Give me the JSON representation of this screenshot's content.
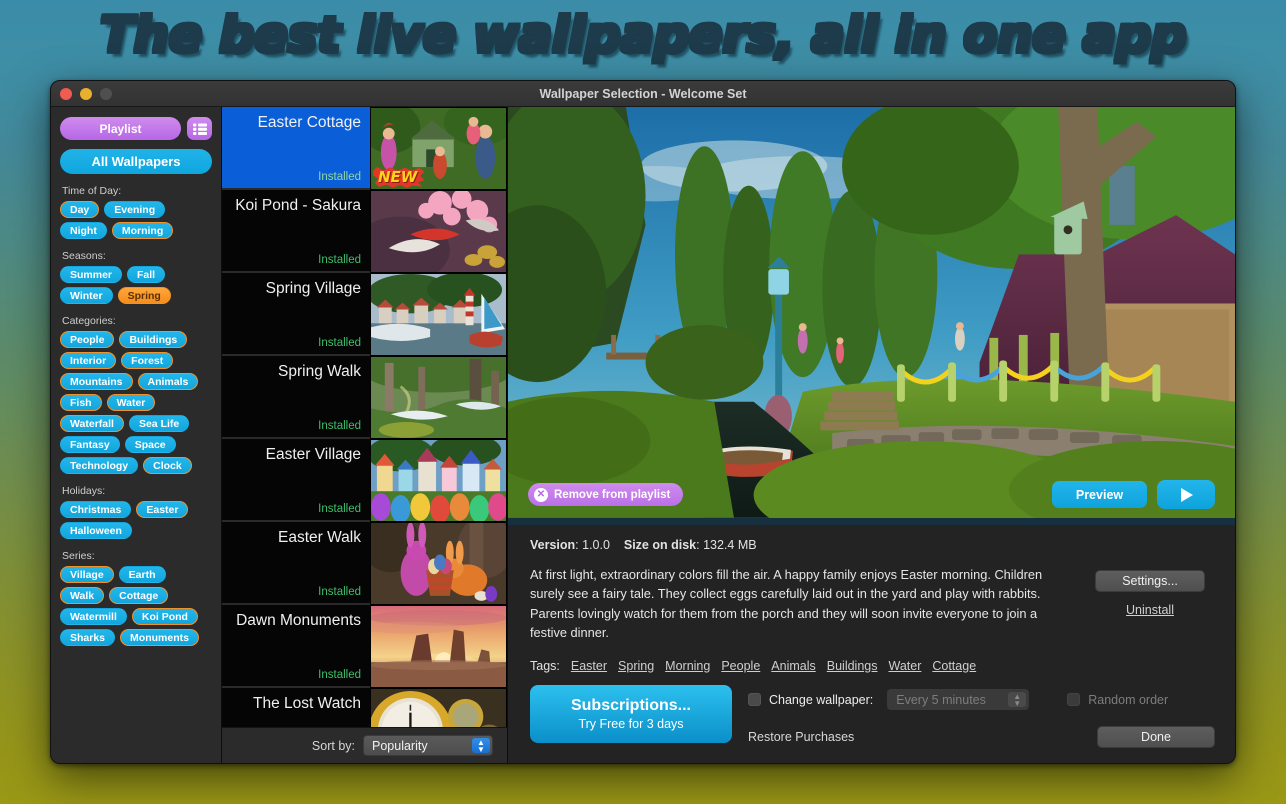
{
  "headline": "The best live wallpapers, all in one app",
  "window": {
    "title": "Wallpaper Selection - Welcome Set",
    "traffic_lights": [
      "close-red",
      "minimize-yellow",
      "zoom-disabled-grey"
    ]
  },
  "sidebar": {
    "playlist_button": "Playlist",
    "list_view_icon": "list-icon",
    "all_wallpapers_button": "All Wallpapers",
    "groups": [
      {
        "label": "Time of Day:",
        "chips": [
          {
            "label": "Day",
            "state": "outlined"
          },
          {
            "label": "Evening",
            "state": "normal"
          },
          {
            "label": "Night",
            "state": "normal"
          },
          {
            "label": "Morning",
            "state": "outlined"
          }
        ]
      },
      {
        "label": "Seasons:",
        "chips": [
          {
            "label": "Summer",
            "state": "normal"
          },
          {
            "label": "Fall",
            "state": "normal"
          },
          {
            "label": "Winter",
            "state": "normal"
          },
          {
            "label": "Spring",
            "state": "selected"
          }
        ]
      },
      {
        "label": "Categories:",
        "chips": [
          {
            "label": "People",
            "state": "outlined"
          },
          {
            "label": "Buildings",
            "state": "outlined"
          },
          {
            "label": "Interior",
            "state": "outlined"
          },
          {
            "label": "Forest",
            "state": "outlined"
          },
          {
            "label": "Mountains",
            "state": "outlined"
          },
          {
            "label": "Animals",
            "state": "outlined"
          },
          {
            "label": "Fish",
            "state": "outlined"
          },
          {
            "label": "Water",
            "state": "outlined"
          },
          {
            "label": "Waterfall",
            "state": "outlined"
          },
          {
            "label": "Sea Life",
            "state": "normal"
          },
          {
            "label": "Fantasy",
            "state": "normal"
          },
          {
            "label": "Space",
            "state": "normal"
          },
          {
            "label": "Technology",
            "state": "normal"
          },
          {
            "label": "Clock",
            "state": "outlined"
          }
        ]
      },
      {
        "label": "Holidays:",
        "chips": [
          {
            "label": "Christmas",
            "state": "normal"
          },
          {
            "label": "Easter",
            "state": "outlined"
          },
          {
            "label": "Halloween",
            "state": "normal"
          }
        ]
      },
      {
        "label": "Series:",
        "chips": [
          {
            "label": "Village",
            "state": "outlined"
          },
          {
            "label": "Earth",
            "state": "normal"
          },
          {
            "label": "Walk",
            "state": "outlined"
          },
          {
            "label": "Cottage",
            "state": "outlined"
          },
          {
            "label": "Watermill",
            "state": "normal"
          },
          {
            "label": "Koi Pond",
            "state": "outlined"
          },
          {
            "label": "Sharks",
            "state": "normal"
          },
          {
            "label": "Monuments",
            "state": "outlined"
          }
        ]
      }
    ]
  },
  "wallpaper_list": {
    "items": [
      {
        "name": "Easter Cottage",
        "status": "Installed",
        "selected": true,
        "badge": "NEW",
        "art": "cottage-family"
      },
      {
        "name": "Koi Pond - Sakura",
        "status": "Installed",
        "selected": false,
        "badge": "",
        "art": "koi-sakura"
      },
      {
        "name": "Spring Village",
        "status": "Installed",
        "selected": false,
        "badge": "",
        "art": "spring-village"
      },
      {
        "name": "Spring Walk",
        "status": "Installed",
        "selected": false,
        "badge": "",
        "art": "spring-walk"
      },
      {
        "name": "Easter Village",
        "status": "Installed",
        "selected": false,
        "badge": "",
        "art": "easter-village"
      },
      {
        "name": "Easter Walk",
        "status": "Installed",
        "selected": false,
        "badge": "",
        "art": "easter-walk"
      },
      {
        "name": "Dawn Monuments",
        "status": "Installed",
        "selected": false,
        "badge": "",
        "art": "dawn-monuments"
      },
      {
        "name": "The Lost Watch",
        "status": "",
        "selected": false,
        "badge": "",
        "art": "lost-watch"
      }
    ],
    "sort_label": "Sort by:",
    "sort_value": "Popularity"
  },
  "preview": {
    "scene": "easter-cottage-scene",
    "remove_button": "Remove from playlist",
    "preview_button": "Preview",
    "play_button_icon": "play-icon"
  },
  "details": {
    "version_label": "Version",
    "version_value": "1.0.0",
    "size_label": "Size on disk",
    "size_value": "132.4 MB",
    "description": "At first light, extraordinary colors fill the air. A happy family enjoys Easter morning. Children surely see a fairy tale. They collect eggs carefully laid out in the yard and play with rabbits. Parents lovingly watch for them from the porch and they will soon invite everyone to join a festive dinner.",
    "tags_label": "Tags:",
    "tags": [
      "Easter",
      "Spring",
      "Morning",
      "People",
      "Animals",
      "Buildings",
      "Water",
      "Cottage"
    ],
    "settings_button": "Settings...",
    "uninstall_link": "Uninstall"
  },
  "footer": {
    "subscriptions_title": "Subscriptions...",
    "subscriptions_sub": "Try Free for 3 days",
    "change_wallpaper_label": "Change wallpaper:",
    "change_wallpaper_checked": false,
    "interval_value": "Every 5 minutes",
    "interval_disabled": true,
    "random_order_label": "Random order",
    "random_order_checked": false,
    "random_order_disabled": true,
    "restore_purchases": "Restore Purchases",
    "done_button": "Done"
  },
  "colors": {
    "accent_blue": "#12A6DE",
    "accent_purple": "#B667E6",
    "accent_orange": "#F0922A",
    "selected_row": "#0A5FD8",
    "installed_green": "#3FBF6B",
    "headline_orange": "#F79233"
  }
}
